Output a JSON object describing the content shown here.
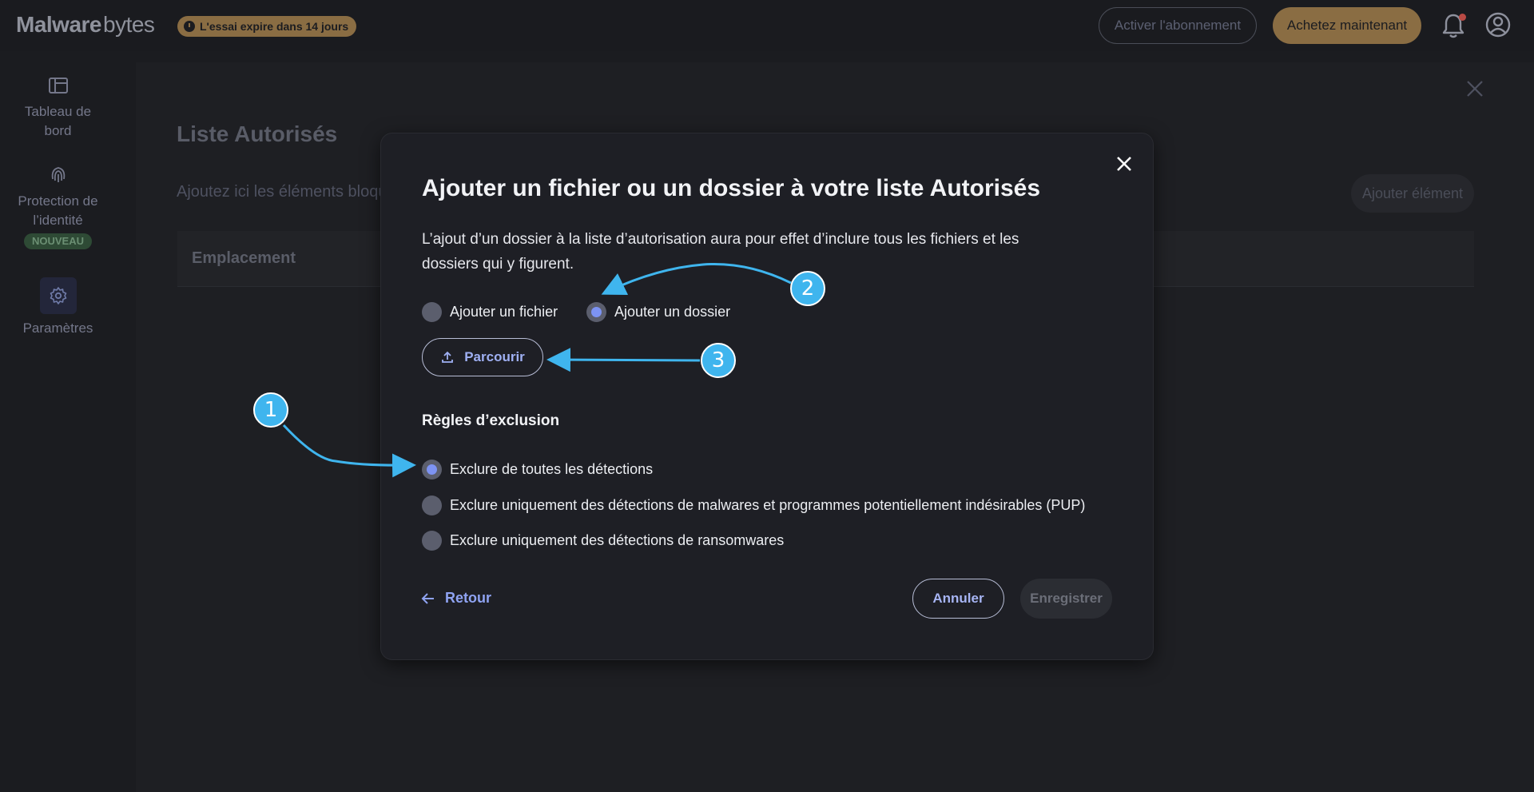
{
  "topbar": {
    "logo_text": "Malwarebytes",
    "logo_bold": "Malware",
    "logo_light": "bytes",
    "trial_badge": "L'essai expire dans 14 jours",
    "activate_label": "Activer l'abonnement",
    "buy_label": "Achetez maintenant",
    "icons": [
      "clock-icon",
      "bell-icon",
      "account-icon"
    ]
  },
  "sidebar": {
    "items": [
      {
        "label_line1": "Tableau de",
        "label_line2": "bord",
        "icon": "dashboard-icon"
      },
      {
        "label_line1": "Protection de",
        "label_line2": "l’identité",
        "badge": "NOUVEAU",
        "icon": "fingerprint-icon"
      },
      {
        "label_line1": "Paramètres",
        "icon": "gear-icon"
      }
    ]
  },
  "panel": {
    "title": "Liste Autorisés",
    "description": "Ajoutez ici les éléments bloqu",
    "add_button": "Ajouter élément",
    "column_header": "Emplacement"
  },
  "modal": {
    "title": "Ajouter un fichier ou un dossier à votre liste Autorisés",
    "description_line1": "L’ajout d’un dossier à la liste d’autorisation aura pour effet d’inclure tous les fichiers et les",
    "description_line2": "dossiers qui y figurent.",
    "type_options": [
      {
        "label": "Ajouter un fichier",
        "checked": false
      },
      {
        "label": "Ajouter un dossier",
        "checked": true
      }
    ],
    "browse_label": "Parcourir",
    "exclusion_title": "Règles d’exclusion",
    "exclusion_options": [
      {
        "label": "Exclure de toutes les détections",
        "checked": true
      },
      {
        "label": "Exclure uniquement des détections de malwares et programmes potentiellement indésirables (PUP)",
        "checked": false
      },
      {
        "label": "Exclure uniquement des détections de ransomwares",
        "checked": false
      }
    ],
    "back_label": "Retour",
    "cancel_label": "Annuler",
    "save_label": "Enregistrer"
  },
  "annotations": {
    "step1": "1",
    "step2": "2",
    "step3": "3",
    "color": "#3fb5ee"
  },
  "colors": {
    "accent": "#7d93f3",
    "trial": "#8a6d43",
    "new_badge": "#2e4a35"
  }
}
